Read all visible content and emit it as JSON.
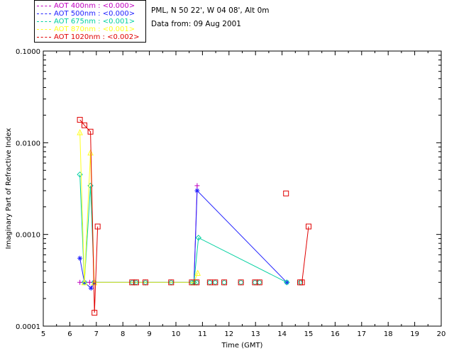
{
  "legend": [
    {
      "label": "AOT  400nm : <0.000>",
      "color": "#c000c0"
    },
    {
      "label": "AOT  500nm : <0.000>",
      "color": "#2020ff"
    },
    {
      "label": "AOT  675nm : <0.001>",
      "color": "#00d0a0"
    },
    {
      "label": "AOT  870nm : <0.001>",
      "color": "#ffff20"
    },
    {
      "label": "AOT 1020nm : <0.002>",
      "color": "#e00000"
    }
  ],
  "site": {
    "location": "PML, N 50 22', W 04 08', Alt 0m",
    "date": "Data from: 09 Aug 2001"
  },
  "chart_data": {
    "type": "line",
    "xlabel": "Time (GMT)",
    "ylabel": "Imaginary Part of Refractive Index",
    "xlim": [
      5,
      20
    ],
    "ylim": [
      0.0001,
      0.1
    ],
    "ylog": true,
    "xticks": [
      "5",
      "6",
      "7",
      "8",
      "9",
      "10",
      "11",
      "12",
      "13",
      "14",
      "15",
      "16",
      "17",
      "18",
      "19",
      "20"
    ],
    "yticks": [
      "0.0001",
      "0.0010",
      "0.0100",
      "0.1000"
    ],
    "series": [
      {
        "name": "AOT  400nm : <0.000>",
        "marker": "plus",
        "x": [
          6.38,
          6.55,
          6.75,
          6.9,
          10.68,
          10.8
        ],
        "y": [
          0.0003,
          0.0003,
          0.0003,
          0.0003,
          0.0003,
          0.0034
        ]
      },
      {
        "name": "AOT  500nm : <0.000>",
        "marker": "star",
        "x": [
          6.38,
          6.55,
          6.8,
          6.92,
          10.68,
          10.8,
          14.18
        ],
        "y": [
          0.00055,
          0.0003,
          0.00026,
          0.0003,
          0.0003,
          0.003,
          0.0003
        ]
      },
      {
        "name": "AOT  675nm : <0.001>",
        "marker": "diamond",
        "x": [
          6.38,
          6.55,
          6.78,
          6.92,
          10.68,
          10.85,
          14.18
        ],
        "y": [
          0.0045,
          0.0003,
          0.0034,
          0.0003,
          0.0003,
          0.00092,
          0.0003
        ]
      },
      {
        "name": "AOT  870nm : <0.001>",
        "marker": "triangle",
        "x": [
          6.38,
          6.55,
          6.78,
          6.92,
          10.68,
          10.82
        ],
        "y": [
          0.013,
          0.0003,
          0.0078,
          0.0003,
          0.0003,
          0.00038
        ]
      },
      {
        "name": "AOT 1020nm : <0.002>",
        "marker": "square",
        "x": [
          6.38,
          6.55,
          6.78,
          6.93,
          7.05
        ],
        "y": [
          0.0178,
          0.0155,
          0.0132,
          0.00014,
          0.00122
        ]
      },
      {
        "name": "AOT 1020nm : <0.002>",
        "marker": "square",
        "x": [
          14.75,
          15.0
        ],
        "y": [
          0.0003,
          0.00122
        ]
      }
    ],
    "isolated_points": {
      "marker": "square",
      "x": [
        8.35,
        8.5,
        8.85,
        9.82,
        10.6,
        10.78,
        11.28,
        11.48,
        11.82,
        12.45,
        12.98,
        13.15,
        14.15,
        14.68
      ],
      "y": [
        0.0003,
        0.0003,
        0.0003,
        0.0003,
        0.0003,
        0.0003,
        0.0003,
        0.0003,
        0.0003,
        0.0003,
        0.0003,
        0.0003,
        0.0028,
        0.0003
      ]
    }
  }
}
